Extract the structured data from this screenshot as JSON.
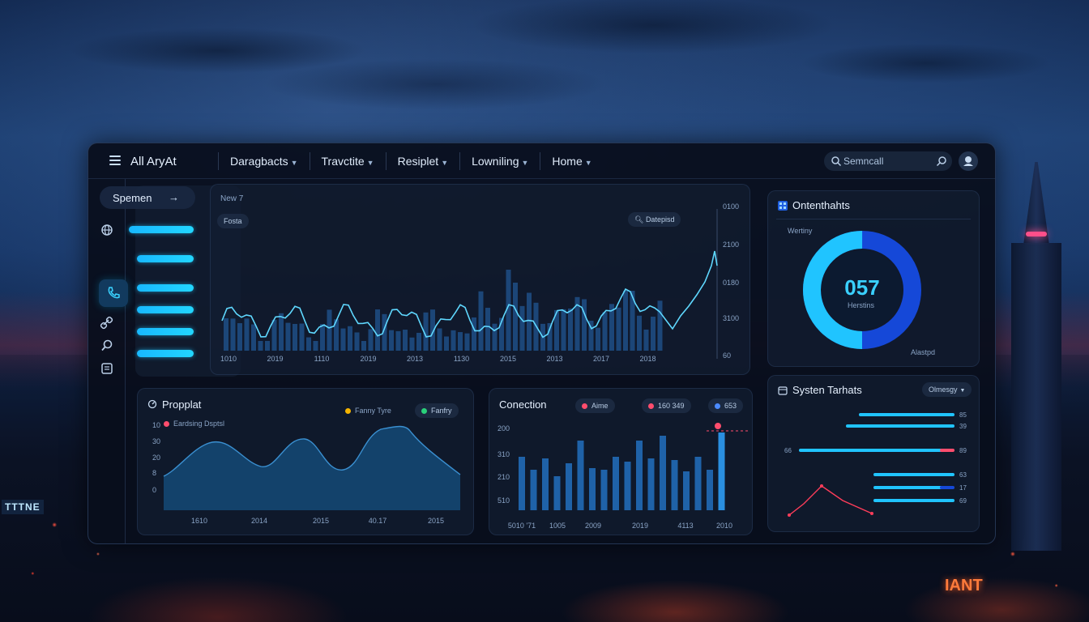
{
  "app": {
    "title": "All AryAt"
  },
  "nav": [
    {
      "label": "Daragbacts"
    },
    {
      "label": "Travctite"
    },
    {
      "label": "Resiplet"
    },
    {
      "label": "Lowniling"
    },
    {
      "label": "Home"
    }
  ],
  "search": {
    "placeholder": "Semncall"
  },
  "sidebar": {
    "header": "Spemen"
  },
  "main_chart": {
    "label": "New 7",
    "filter": "Fosta",
    "search_chip": "Datepisd",
    "y_ticks": [
      "0100",
      "2100",
      "0180",
      "3100",
      "60"
    ],
    "x_ticks": [
      "1010",
      "2019",
      "1110",
      "2019",
      "2013",
      "1130",
      "2015",
      "2013",
      "2017",
      "2018"
    ],
    "colors": {
      "line": "#5fd8ff",
      "bars": "#1f4f86",
      "spike": "#8fe3ff"
    }
  },
  "donut": {
    "title": "Ontenthahts",
    "sub_label": "Wertiny",
    "value": "057",
    "caption": "Herstins",
    "footer": "Alastpd",
    "split": 0.5,
    "colors": {
      "a": "#20c4ff",
      "b": "#1548d8"
    }
  },
  "area_card": {
    "title": "Propplat",
    "legend": [
      {
        "label": "Fanny Tyre",
        "color": "#f5b400"
      },
      {
        "label": "Fanfry",
        "color": "#2ad07a"
      }
    ],
    "series_label": "Eardsing Dsptsl",
    "y_ticks": [
      "10",
      "30",
      "20",
      "8",
      "0"
    ],
    "x_ticks": [
      "1610",
      "2014",
      "2015",
      "40.17",
      "2015"
    ]
  },
  "bar_card": {
    "title": "Conection",
    "chips": [
      {
        "label": "Aime",
        "color": "#ff4d6d"
      },
      {
        "label": "160 349",
        "color": "#ff4d6d"
      },
      {
        "label": "653",
        "color": "#4b8bff"
      }
    ],
    "y_ticks": [
      "200",
      "310",
      "210",
      "510"
    ],
    "x_ticks": [
      "5010 '71",
      "1005",
      "2009",
      "2019",
      "4113",
      "2010"
    ],
    "values": [
      66,
      50,
      64,
      42,
      58,
      86,
      52,
      50,
      66,
      60,
      86,
      64,
      92,
      62,
      48,
      66,
      50,
      96
    ]
  },
  "targets_card": {
    "title": "Systen Tarhats",
    "dropdown": "Olmesgy",
    "rows": [
      {
        "label": "",
        "value": "85"
      },
      {
        "label": "",
        "value": "39"
      },
      {
        "label": "66",
        "value": "89"
      },
      {
        "label": "",
        "value": "63"
      },
      {
        "label": "",
        "value": "17"
      },
      {
        "label": "",
        "value": "69"
      }
    ]
  },
  "background": {
    "sign_left": "TTTNE",
    "sign_right": "IANT"
  }
}
